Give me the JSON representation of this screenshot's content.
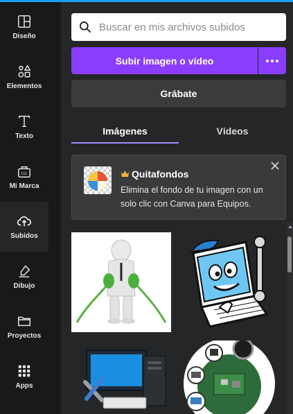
{
  "sidebar": {
    "items": [
      {
        "label": "Diseño",
        "icon": "layout-icon"
      },
      {
        "label": "Elementos",
        "icon": "shapes-icon"
      },
      {
        "label": "Texto",
        "icon": "text-icon"
      },
      {
        "label": "Mi Marca",
        "icon": "brand-kit-icon"
      },
      {
        "label": "Subidos",
        "icon": "cloud-upload-icon",
        "active": true
      },
      {
        "label": "Dibujo",
        "icon": "draw-pen-icon"
      },
      {
        "label": "Proyectos",
        "icon": "folder-icon"
      },
      {
        "label": "Apps",
        "icon": "apps-grid-icon"
      }
    ]
  },
  "search": {
    "placeholder": "Buscar en mis archivos subidos",
    "value": ""
  },
  "actions": {
    "upload_label": "Subir imagen o vídeo",
    "more_icon": "more-dots-icon",
    "record_label": "Grábate"
  },
  "tabs": [
    {
      "label": "Imágenes",
      "active": true
    },
    {
      "label": "Vídeos",
      "active": false
    }
  ],
  "promo": {
    "title": "Quitafondos",
    "description": "Elimina el fondo de tu imagen con un solo clic con Canva para Equipos.",
    "icon": "crown-icon"
  },
  "uploads": [
    {
      "name": "uploaded-image-plug-figure"
    },
    {
      "name": "uploaded-image-laptop-wrench"
    },
    {
      "name": "uploaded-image-computer-tools"
    },
    {
      "name": "uploaded-image-hardware-collage"
    }
  ],
  "colors": {
    "accent": "#8b3dff",
    "top_bar": "#1ea1f2",
    "panel_bg": "#252627",
    "rail_bg": "#18191b"
  }
}
